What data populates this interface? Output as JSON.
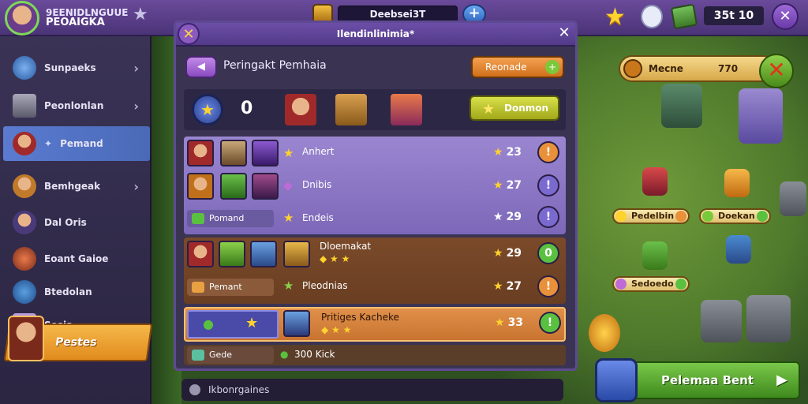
{
  "player": {
    "line1": "9EENIDLNGUUE",
    "line2": "PEOAIGKA"
  },
  "topbar": {
    "center_value": "Deebsei3T",
    "resource_count": "35t 10",
    "plus": "+",
    "close": "✕"
  },
  "sidebar": {
    "items": [
      {
        "label": "Sunpaeks",
        "chevron": true
      },
      {
        "label": "Peonlonlan",
        "chevron": true
      },
      {
        "label": "Pemand",
        "chevron": false,
        "active": true
      },
      {
        "label": "Bemhgeak",
        "chevron": true
      },
      {
        "label": "Dal Oris",
        "chevron": false
      },
      {
        "label": "Eoant Gaioe",
        "chevron": false
      },
      {
        "label": "Btedolan",
        "chevron": false
      },
      {
        "label": "Sosia",
        "chevron": false
      }
    ],
    "promo_label": "Pestes"
  },
  "panel": {
    "title": "Ilendinlinimia*",
    "close_left": "✕",
    "close_right": "✕",
    "subhead_title": "Peringakt Pemhaia",
    "resource_button": "Reonade",
    "summary_count": "0",
    "claim_button": "Donmon",
    "rows": [
      {
        "label": "Anhert",
        "value": "23",
        "btn": "!"
      },
      {
        "label": "Dnibis",
        "value": "27",
        "btn": "!"
      },
      {
        "tag": "Pomand",
        "label": "Endeis",
        "value": "29",
        "btn": "!"
      },
      {
        "label": "Dloemakat",
        "value": "29",
        "btn": "0"
      },
      {
        "tag": "Pemant",
        "label": "Pleodnias",
        "value": "27",
        "btn": "!"
      },
      {
        "label": "Pritiges Kacheke",
        "value": "33",
        "btn": "!"
      },
      {
        "tag": "Gede",
        "label": "300 Kick"
      }
    ],
    "bottom_field": "Ikbonrgaines"
  },
  "map": {
    "bar_label": "Mecne",
    "bar_value": "770",
    "nodes": [
      {
        "label": "Pedelbin"
      },
      {
        "label": "Doekan"
      },
      {
        "label": "Sedoedo"
      }
    ],
    "big_button": "Pelemaa Bent"
  },
  "colors": {
    "accent_purple": "#6c4ea8",
    "accent_green": "#5ac040",
    "accent_orange": "#e0904a",
    "star": "#ffd22e"
  }
}
